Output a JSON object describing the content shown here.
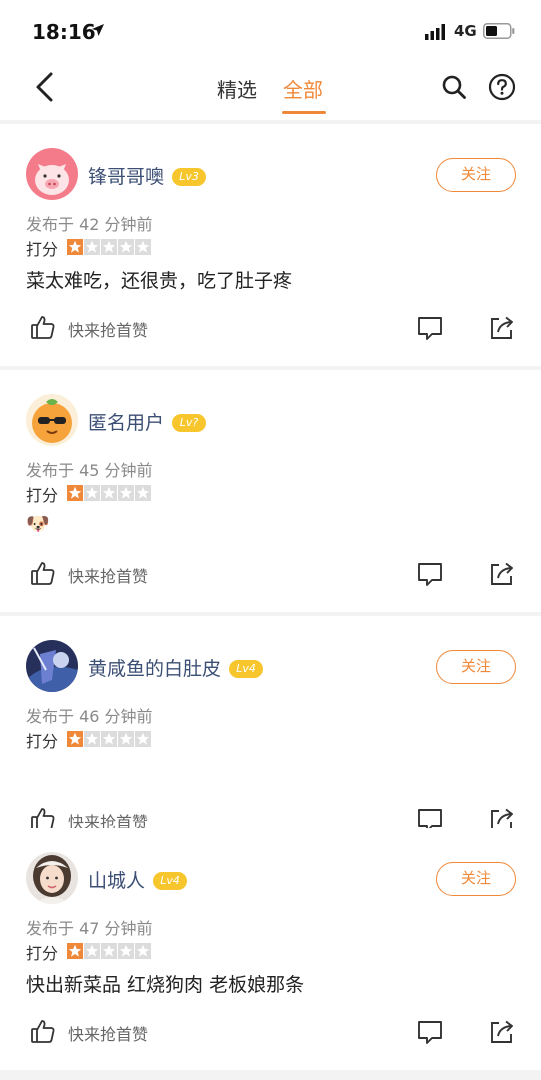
{
  "status_bar": {
    "time": "18:16",
    "network": "4G"
  },
  "nav": {
    "tabs": [
      {
        "label": "精选",
        "active": false
      },
      {
        "label": "全部",
        "active": true
      }
    ],
    "accent_color": "#f0883a"
  },
  "reviews": [
    {
      "username": "锋哥哥噢",
      "level": "Lv3",
      "show_follow": true,
      "follow_label": "关注",
      "time": "发布于 42 分钟前",
      "rating_label": "打分",
      "rating": 1,
      "text": "菜太难吃，还很贵，吃了肚子疼",
      "like_label": "快来抢首赞"
    },
    {
      "username": "匿名用户",
      "level": "Lv?",
      "show_follow": false,
      "follow_label": "",
      "time": "发布于 45 分钟前",
      "rating_label": "打分",
      "rating": 1,
      "text": "🐶",
      "like_label": "快来抢首赞"
    },
    {
      "username": "黄咸鱼的白肚皮",
      "level": "Lv4",
      "show_follow": true,
      "follow_label": "关注",
      "time": "发布于 46 分钟前",
      "rating_label": "打分",
      "rating": 1,
      "text": "",
      "like_label": "快来抢首赞"
    },
    {
      "username": "山城人",
      "level": "Lv4",
      "show_follow": true,
      "follow_label": "关注",
      "time": "发布于 47 分钟前",
      "rating_label": "打分",
      "rating": 1,
      "text": "快出新菜品 红烧狗肉 老板娘那条",
      "like_label": "快来抢首赞"
    }
  ]
}
